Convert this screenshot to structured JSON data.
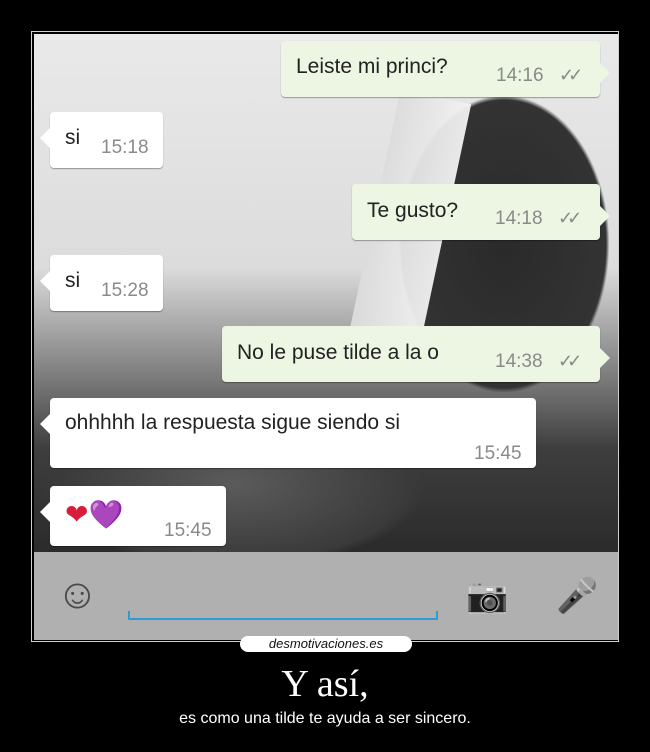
{
  "messages": [
    {
      "dir": "out",
      "text": "Leiste mi princi?",
      "time": "14:16",
      "ticks": "✓✓"
    },
    {
      "dir": "in",
      "text": "si",
      "time": "15:18"
    },
    {
      "dir": "out",
      "text": "Te gusto?",
      "time": "14:18",
      "ticks": "✓✓"
    },
    {
      "dir": "in",
      "text": "si",
      "time": "15:28"
    },
    {
      "dir": "out",
      "text": "No le puse tilde a la o",
      "time": "14:38",
      "ticks": "✓✓"
    },
    {
      "dir": "in",
      "text": "ohhhhh la respuesta sigue siendo si",
      "time": "15:45"
    },
    {
      "dir": "in",
      "text": "❤💜",
      "time": "15:45"
    }
  ],
  "input_bar": {
    "emoji_icon": "☺",
    "camera_icon": "📷",
    "mic_icon": "🎤",
    "accent_color": "#2f9bd4"
  },
  "poster": {
    "brand": "desmotivaciones.es",
    "headline": "Y así,",
    "subtitle": "es como una tilde te ayuda a ser  sincero."
  }
}
